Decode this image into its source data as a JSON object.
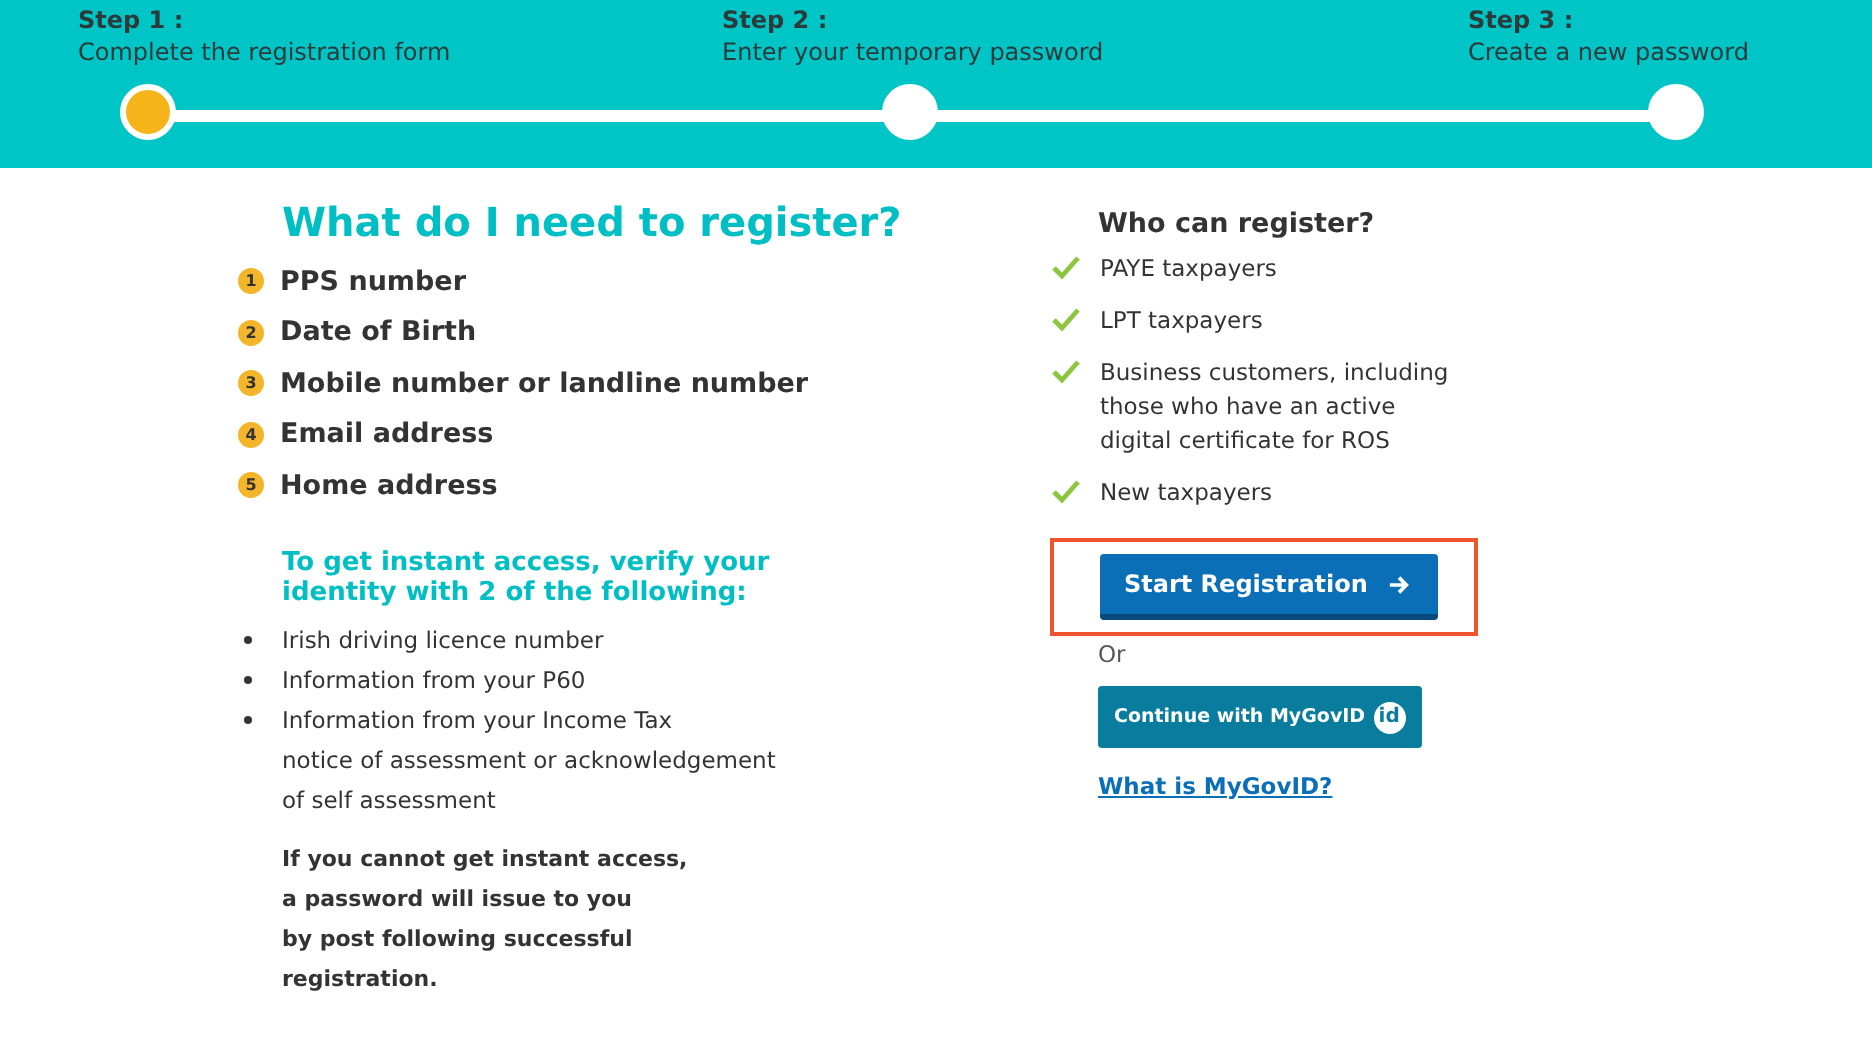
{
  "steps": [
    {
      "label": "Step 1 :",
      "description": "Complete the registration form",
      "selected": true
    },
    {
      "label": "Step 2 :",
      "description": "Enter your temporary password",
      "selected": false
    },
    {
      "label": "Step 3 :",
      "description": "Create a new password",
      "selected": false
    }
  ],
  "requirements": {
    "title": "What do I need to register?",
    "items": [
      {
        "number": "1",
        "text": "PPS number"
      },
      {
        "number": "2",
        "text": "Date of Birth"
      },
      {
        "number": "3",
        "text": "Mobile number or landline number"
      },
      {
        "number": "4",
        "text": "Email address"
      },
      {
        "number": "5",
        "text": "Home address"
      }
    ],
    "instant_access": {
      "title": "To get instant access, verify your identity with 2 of the following:",
      "items": [
        {
          "lines": [
            "Irish driving licence number"
          ]
        },
        {
          "lines": [
            "Information from your P60"
          ]
        },
        {
          "lines": [
            "Information from your Income Tax",
            "notice of assessment or acknowledgement",
            "of self assessment"
          ]
        }
      ]
    },
    "note_lines": [
      "If you cannot get instant access,",
      "a password will issue to you",
      "by post following successful",
      "registration."
    ]
  },
  "eligibility": {
    "title": "Who can register?",
    "items": [
      {
        "lines": [
          "PAYE taxpayers"
        ]
      },
      {
        "lines": [
          "LPT taxpayers"
        ]
      },
      {
        "lines": [
          "Business customers, including",
          "those who have an active",
          "digital certificate for ROS"
        ]
      },
      {
        "lines": [
          "New taxpayers"
        ]
      }
    ],
    "start_button": {
      "label": "Start Registration",
      "highlighted": true
    },
    "or_text": "Or",
    "mygovid_button": {
      "label": "Continue with MyGovID",
      "badge": "id"
    },
    "link": "What is MyGovID?"
  }
}
